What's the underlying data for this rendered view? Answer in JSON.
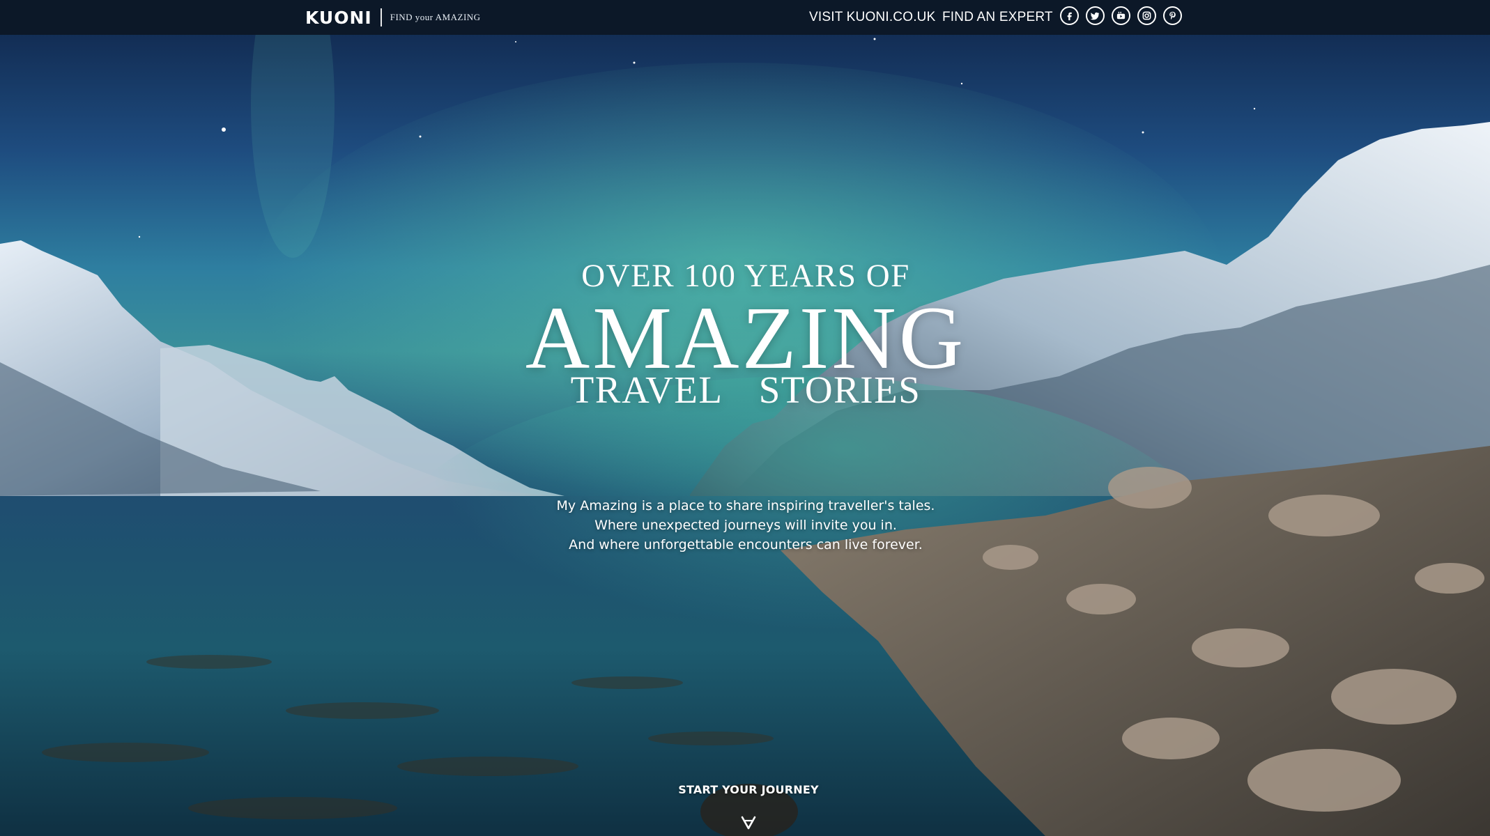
{
  "header": {
    "logo_word": "KUONI",
    "logo_tagline": "FIND your AMAZING",
    "nav": {
      "visit_label": "VISIT KUONI.CO.UK",
      "expert_label": "FIND AN EXPERT"
    },
    "socials": [
      "facebook-icon",
      "twitter-icon",
      "youtube-icon",
      "instagram-icon",
      "pinterest-icon"
    ]
  },
  "hero": {
    "line1": "OVER 100 YEARS OF",
    "line2": "AMAZING",
    "line3": "TRAVEL STORIES",
    "tagline": [
      "My Amazing is a place to share inspiring traveller's tales.",
      "Where unexpected journeys will invite you in.",
      "And where unforgettable encounters can live forever."
    ],
    "cta_label": "START YOUR JOURNEY",
    "cta_icon": "chevron-down-icon"
  },
  "colors": {
    "topbar": "#0c1828",
    "text": "#ffffff",
    "sky": "#1e4c7f",
    "aurora": "#3a9a8a"
  }
}
